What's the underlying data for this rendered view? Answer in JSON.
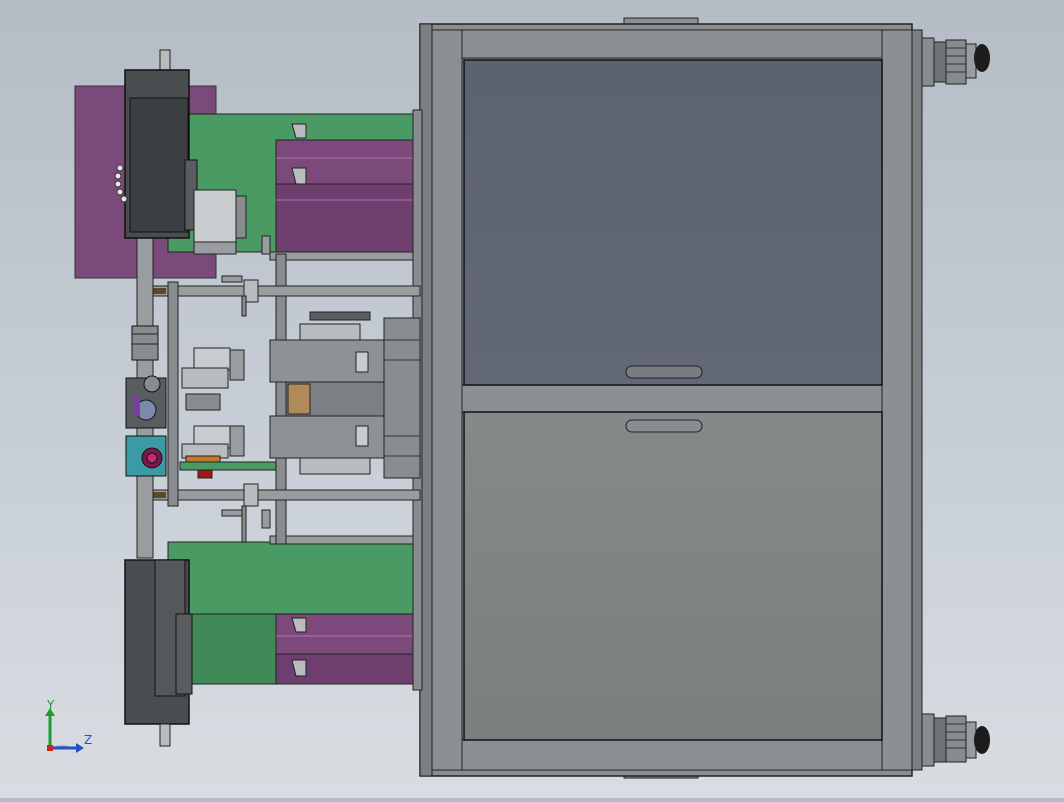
{
  "scene": {
    "type": "cad-model-view",
    "colors": {
      "background_top": "#b4bcc6",
      "background_bottom": "#d9dde2",
      "frame_grey": "#8a8d8f",
      "panel_dark": "#5d6470",
      "panel_light": "#7f8283",
      "green_part": "#4a9a63",
      "magenta_part": "#7b4a7b",
      "motor_dark": "#4a4d50",
      "teal_part": "#3c9aa6",
      "orange_part": "#c07a2a",
      "axis_y": "#1f9a2e",
      "axis_z": "#2a4dc8"
    }
  },
  "axis_triad": {
    "y_label": "Y",
    "z_label": "Z"
  }
}
